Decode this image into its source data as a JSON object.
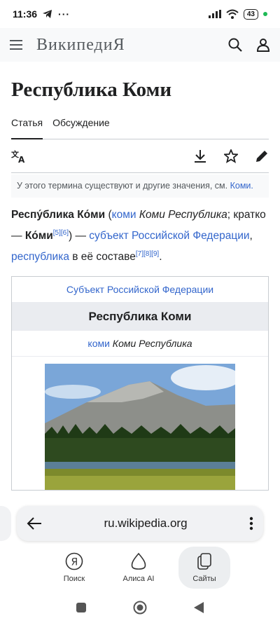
{
  "status": {
    "time": "11:36",
    "battery": "43"
  },
  "header": {
    "logo": "ВикипедиЯ"
  },
  "article": {
    "title": "Республика Коми",
    "tabs": [
      "Статья",
      "Обсуждение"
    ],
    "hatnote_text": "У этого термина существуют и другие значения, см.",
    "hatnote_link": "Коми.",
    "lead": {
      "p1": "Респу́блика Ко́ми",
      "p2": " (",
      "p3": "коми",
      "p4": " Коми Республика",
      "p5": ";",
      "p6": " кратко — ",
      "p7": "Ко́ми",
      "ref1": "[5][6]",
      "p8": ") — ",
      "p9": "субъект Российской Федерации",
      "p10": ", ",
      "p11": "республика",
      "p12": " в её составе",
      "ref2": "[7][8][9]",
      "p13": "."
    },
    "infobox": {
      "caption": "Субъект Российской Федерации",
      "name": "Республика Коми",
      "lang_link": "коми",
      "native_name": " Коми Республика"
    }
  },
  "browser": {
    "url": "ru.wikipedia.org",
    "nav": [
      {
        "label": "Поиск",
        "icon": "yandex-search-icon"
      },
      {
        "label": "Алиса AI",
        "icon": "alice-icon"
      },
      {
        "label": "Сайты",
        "icon": "tabs-icon"
      }
    ]
  },
  "colors": {
    "link": "#3366cc",
    "header_bg": "#f8f9fa"
  }
}
